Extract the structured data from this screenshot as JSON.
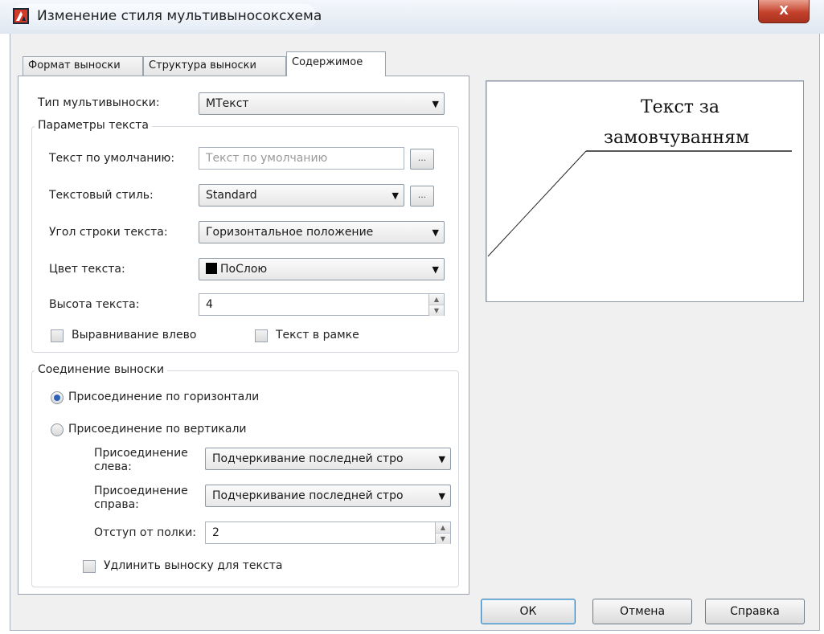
{
  "window": {
    "title": "Изменение стиля мультивыносоксхема",
    "close_label": "X"
  },
  "tabs": [
    {
      "label": "Формат выноски"
    },
    {
      "label": "Структура выноски"
    },
    {
      "label": "Содержимое"
    }
  ],
  "content": {
    "multileader_type_label": "Тип мультивыноски:",
    "multileader_type_value": "МТекст",
    "text_options": {
      "title": "Параметры текста",
      "default_text_label": "Текст по умолчанию:",
      "default_text_placeholder": "Текст по умолчанию",
      "text_style_label": "Текстовый стиль:",
      "text_style_value": "Standard",
      "text_angle_label": "Угол строки текста:",
      "text_angle_value": "Горизонтальное положение",
      "text_color_label": "Цвет текста:",
      "text_color_value": "ПоСлою",
      "text_height_label": "Высота текста:",
      "text_height_value": "4",
      "left_justify_label": "Выравнивание влево",
      "frame_text_label": "Текст в рамке",
      "browse_label": "..."
    },
    "leader_connection": {
      "title": "Соединение выноски",
      "horizontal_label": "Присоединение по горизонтали",
      "vertical_label": "Присоединение по вертикали",
      "attach_left_label_1": "Присоединение",
      "attach_left_label_2": "слева:",
      "attach_left_value": "Подчеркивание последней стро",
      "attach_right_label_1": "Присоединение",
      "attach_right_label_2": "справа:",
      "attach_right_value": "Подчеркивание последней стро",
      "landing_gap_label": "Отступ от полки:",
      "landing_gap_value": "2",
      "extend_leader_label": "Удлинить выноску для текста"
    }
  },
  "preview": {
    "line1": "Текст за",
    "line2": "замовчуванням"
  },
  "buttons": {
    "ok": "ОК",
    "cancel": "Отмена",
    "help": "Справка"
  },
  "colors": {
    "accent": "#2c63b8",
    "close": "#c4412b",
    "text_color_swatch": "#000000"
  }
}
